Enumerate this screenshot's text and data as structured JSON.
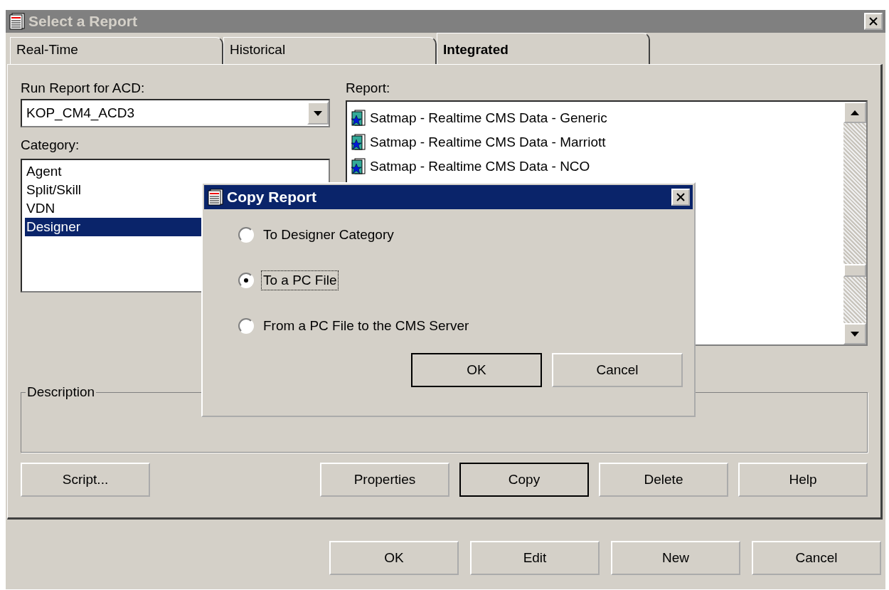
{
  "window": {
    "title": "Select a Report"
  },
  "tabs": [
    {
      "label": "Real-Time",
      "selected": false
    },
    {
      "label": "Historical",
      "selected": false
    },
    {
      "label": "Integrated",
      "selected": true
    }
  ],
  "acd": {
    "label": "Run Report for ACD:",
    "value": "KOP_CM4_ACD3"
  },
  "category": {
    "label": "Category:",
    "items": [
      {
        "label": "Agent",
        "selected": false
      },
      {
        "label": "Split/Skill",
        "selected": false
      },
      {
        "label": "VDN",
        "selected": false
      },
      {
        "label": "Designer",
        "selected": true
      }
    ]
  },
  "report": {
    "label": "Report:",
    "items": [
      {
        "label": "Satmap - Realtime CMS Data - Generic"
      },
      {
        "label": "Satmap - Realtime CMS Data - Marriott"
      },
      {
        "label": "Satmap - Realtime CMS Data - NCO"
      }
    ]
  },
  "description": {
    "label": "Description"
  },
  "panel_buttons": [
    {
      "label": "Script...",
      "default": false
    },
    {
      "label": "Properties",
      "default": false
    },
    {
      "label": "Copy",
      "default": true
    },
    {
      "label": "Delete",
      "default": false
    },
    {
      "label": "Help",
      "default": false
    }
  ],
  "bottom_buttons": [
    {
      "label": "OK"
    },
    {
      "label": "Edit"
    },
    {
      "label": "New"
    },
    {
      "label": "Cancel"
    }
  ],
  "dialog": {
    "title": "Copy Report",
    "options": [
      {
        "label": "To Designer Category",
        "selected": false
      },
      {
        "label": "To a PC File",
        "selected": true
      },
      {
        "label": "From a PC File to the CMS Server",
        "selected": false
      }
    ],
    "buttons": [
      {
        "label": "OK",
        "default": true
      },
      {
        "label": "Cancel",
        "default": false
      }
    ]
  }
}
